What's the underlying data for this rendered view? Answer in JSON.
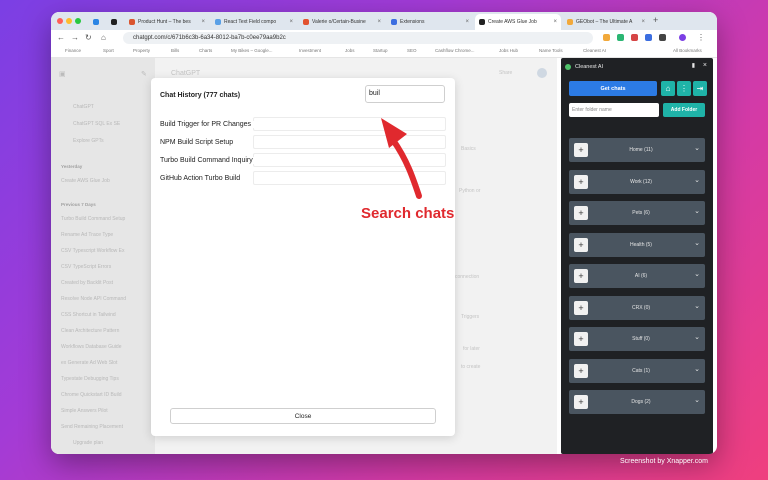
{
  "browser": {
    "tabs": [
      {
        "label": "",
        "fav": "#2b85e4"
      },
      {
        "label": "",
        "fav": "#222222"
      },
      {
        "label": "Product Hunt – The bes",
        "fav": "#da552f"
      },
      {
        "label": "React Text Field compo",
        "fav": "#5aa0e6"
      },
      {
        "label": "Valerie o/Certain-Busine",
        "fav": "#e2522f"
      },
      {
        "label": "Extensions",
        "fav": "#3c6ee0"
      },
      {
        "label": "Create AWS Glue Job",
        "fav": "#222222"
      },
      {
        "label": "GEObot – The Ultimate A",
        "fav": "#f2a93b"
      }
    ],
    "url": "chatgpt.com/c/671b6c3b-6a34-8012-ba7b-c0ee79aa9b2c",
    "bookmarks": [
      "Finance",
      "Sport",
      "Property",
      "Bills",
      "Charts",
      "My Bikes – Google...",
      "Investment",
      "Jobs",
      "Startup",
      "SEO",
      "Cashflow Chrome...",
      "Jobs Hub",
      "Name Tools",
      "Cleanest AI",
      "All Bookmarks"
    ]
  },
  "chatgpt": {
    "top_title": "ChatGPT",
    "share": "Share",
    "sidebar": {
      "items_top": [
        "ChatGPT",
        "ChatGPT SQL Ex SE",
        "Explore GPTs"
      ],
      "head_yesterday": "Yesterday",
      "yesterday": [
        "Create AWS Glue Job"
      ],
      "head_prev": "Previous 7 Days",
      "prev": [
        "Turbo Build Command Setup",
        "Rename Ad Trace Type",
        "CSV Typescript Workflow Ex",
        "CSV TypeScript Errors",
        "Created by Backlit Post",
        "Resolve Node API Command",
        "CSS Shortcut in Tailwind",
        "Clean Architecture Pattern",
        "Workflows Database Guide",
        "ex Generate Ad Web Slot",
        "Typestate Debugging Tips",
        "Chrome Quickstart ID Build",
        "Simple Answers Pilot",
        "Send Remaining Placement",
        "Print Time Tab Memory"
      ],
      "footer": "Upgrade plan"
    },
    "ghost_texts": [
      "Basics",
      "Python or",
      "connection",
      "Triggers",
      "for later",
      "to create"
    ]
  },
  "modal": {
    "title": "Chat History (777 chats)",
    "search_value": "buil",
    "results": [
      "Build Trigger for PR Changes",
      "NPM Build Script Setup",
      "Turbo Build Command Inquiry",
      "GitHub Action Turbo Build"
    ],
    "close_label": "Close"
  },
  "annotation": {
    "text": "Search chats",
    "color": "#e0292e"
  },
  "panel": {
    "title": "Cleanest AI",
    "get_chats": "Get chats",
    "folder_placeholder": "Enter folder name",
    "add_folder": "Add Folder",
    "folders": [
      "Home (11)",
      "Work (12)",
      "Pets (6)",
      "Health (5)",
      "AI (6)",
      "CRX (0)",
      "Stuff (0)",
      "Cats (1)",
      "Dogs (2)"
    ],
    "accent": "#1fb3a8",
    "primary": "#2c7be5"
  },
  "credit": "Screenshot by Xnapper.com"
}
